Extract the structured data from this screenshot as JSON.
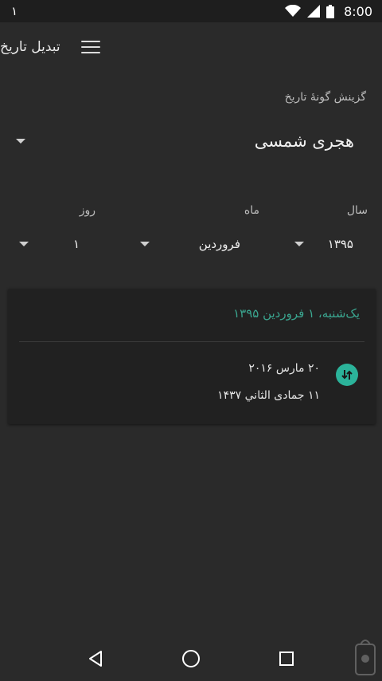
{
  "status": {
    "left_text": "١",
    "time": "8:00"
  },
  "app_bar": {
    "title": "تبدیل تاریخ"
  },
  "date_type": {
    "label": "گزینش گونهٔ تاریخ",
    "selected": "هجری شمسی"
  },
  "fields": {
    "year": {
      "label": "سال",
      "value": "۱۳۹۵"
    },
    "month": {
      "label": "ماه",
      "value": "فروردین"
    },
    "day": {
      "label": "روز",
      "value": "۱"
    }
  },
  "result": {
    "header": "یک‌شنبه، ۱ فروردین ۱۳۹۵",
    "gregorian": "۲۰ مارس ۲۰۱۶",
    "hijri": "۱۱ جمادی الثاني ۱۴۳۷"
  },
  "colors": {
    "accent": "#3aa58f",
    "background": "#2a2a2a",
    "card": "#212121"
  }
}
